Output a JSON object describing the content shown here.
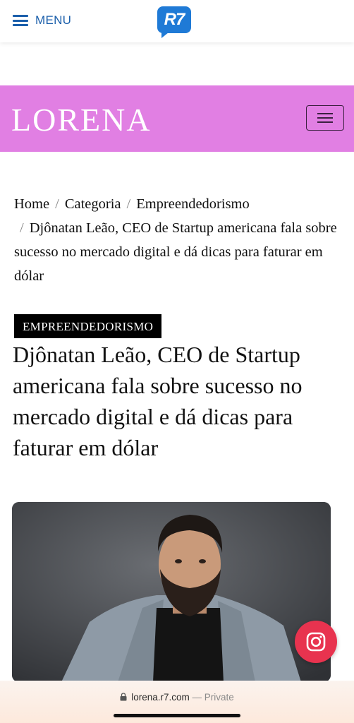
{
  "topbar": {
    "menu_label": "MENU",
    "logo_text": "R7"
  },
  "header": {
    "logo_text": "LORENA"
  },
  "breadcrumb": {
    "items": [
      "Home",
      "Categoria",
      "Empreendedorismo"
    ],
    "current": "Djônatan Leão, CEO de Startup americana fala sobre sucesso no mercado digital e dá dicas para faturar em dólar",
    "separator": "/"
  },
  "article": {
    "category": "EMPREENDEDORISMO",
    "title": "Djônatan Leão, CEO de Startup americana fala sobre sucesso no mercado digital e dá dicas para faturar em dólar"
  },
  "browser": {
    "domain": "lorena.r7.com",
    "privacy": "— Private"
  },
  "colors": {
    "brand_pink": "#e17fe3",
    "r7_blue": "#1f7ad6",
    "instagram": "#e8334f"
  }
}
